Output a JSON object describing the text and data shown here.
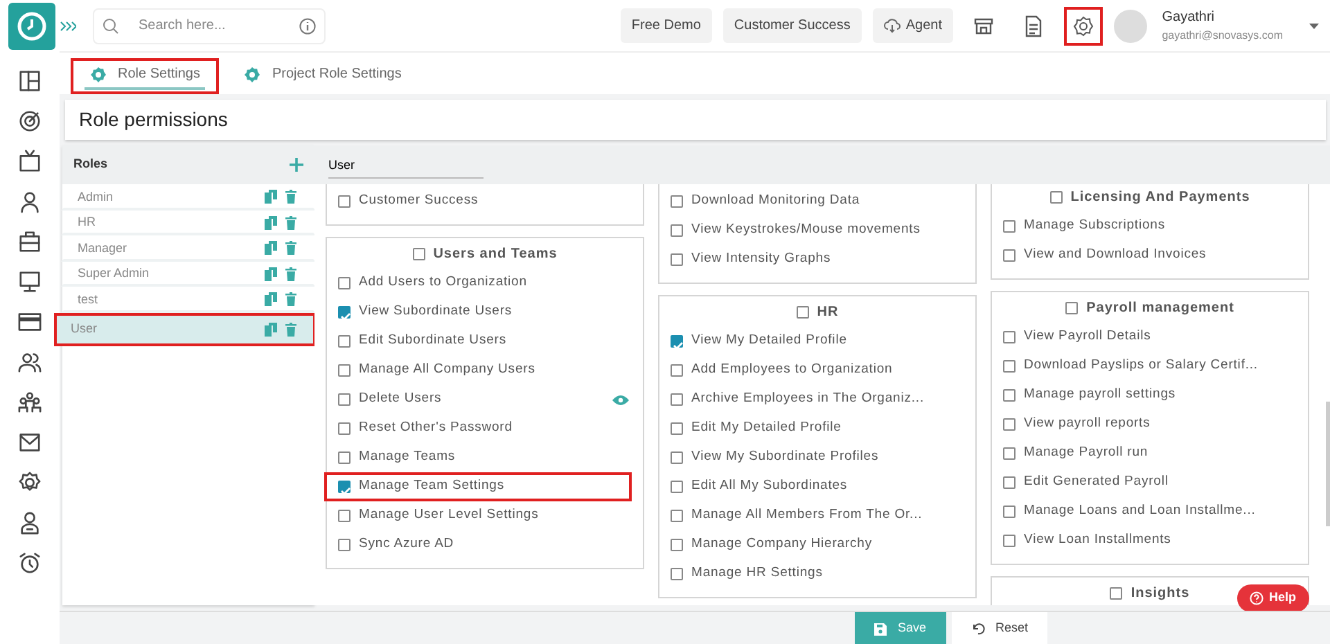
{
  "topbar": {
    "search": {
      "placeholder": "Search here..."
    },
    "buttons": [
      {
        "label": "Free Demo",
        "kind": "text"
      },
      {
        "label": "Customer Success",
        "kind": "text"
      },
      {
        "label": "Agent",
        "kind": "cloud"
      }
    ],
    "icon_buttons": [
      {
        "kind": "store",
        "highlighted": false
      },
      {
        "kind": "document",
        "highlighted": false
      },
      {
        "kind": "settings",
        "highlighted": true
      }
    ],
    "user": {
      "name": "Gayathri",
      "email": "gayathri@snovasys.com"
    }
  },
  "tabs": [
    {
      "label": "Role Settings",
      "selected": true,
      "highlighted": true
    },
    {
      "label": "Project Role Settings",
      "selected": false,
      "highlighted": false
    }
  ],
  "page_title": "Role permissions",
  "roles": {
    "title": "Roles",
    "items": [
      {
        "name": "Admin",
        "selected": false,
        "highlighted": false
      },
      {
        "name": "HR",
        "selected": false,
        "highlighted": false
      },
      {
        "name": "Manager",
        "selected": false,
        "highlighted": false
      },
      {
        "name": "Super Admin",
        "selected": false,
        "highlighted": false
      },
      {
        "name": "test",
        "selected": false,
        "highlighted": false
      },
      {
        "name": "User",
        "selected": true,
        "highlighted": true
      }
    ]
  },
  "role_field": {
    "value": "User"
  },
  "permission_columns": [
    [
      {
        "items": [
          {
            "label": "Customer Success",
            "checked": false,
            "highlighted": false,
            "kind": "plain"
          }
        ]
      },
      {
        "title": "Users and Teams",
        "checked": false,
        "items": [
          {
            "label": "Add Users to Organization",
            "checked": false,
            "highlighted": false,
            "kind": "plain"
          },
          {
            "label": "View Subordinate Users",
            "checked": true,
            "highlighted": false,
            "kind": "plain"
          },
          {
            "label": "Edit Subordinate Users",
            "checked": false,
            "highlighted": false,
            "kind": "plain"
          },
          {
            "label": "Manage All Company Users",
            "checked": false,
            "highlighted": false,
            "kind": "plain"
          },
          {
            "label": "Delete Users",
            "checked": false,
            "highlighted": false,
            "kind": "preview"
          },
          {
            "label": "Reset Other's Password",
            "checked": false,
            "highlighted": false,
            "kind": "plain"
          },
          {
            "label": "Manage Teams",
            "checked": false,
            "highlighted": false,
            "kind": "plain"
          },
          {
            "label": "Manage Team Settings",
            "checked": true,
            "highlighted": true,
            "kind": "plain"
          },
          {
            "label": "Manage User Level Settings",
            "checked": false,
            "highlighted": false,
            "kind": "plain"
          },
          {
            "label": "Sync Azure AD",
            "checked": false,
            "highlighted": false,
            "kind": "plain"
          }
        ]
      }
    ],
    [
      {
        "items": [
          {
            "label": "Download Monitoring Data",
            "checked": false,
            "highlighted": false,
            "kind": "plain"
          },
          {
            "label": "View Keystrokes/Mouse movements",
            "checked": false,
            "highlighted": false,
            "kind": "plain"
          },
          {
            "label": "View Intensity Graphs",
            "checked": false,
            "highlighted": false,
            "kind": "plain"
          }
        ]
      },
      {
        "title": "HR",
        "checked": false,
        "items": [
          {
            "label": "View My Detailed Profile",
            "checked": true,
            "highlighted": false,
            "kind": "plain"
          },
          {
            "label": "Add Employees to Organization",
            "checked": false,
            "highlighted": false,
            "kind": "plain"
          },
          {
            "label": "Archive Employees in The Organiz...",
            "checked": false,
            "highlighted": false,
            "kind": "plain"
          },
          {
            "label": "Edit My Detailed Profile",
            "checked": false,
            "highlighted": false,
            "kind": "plain"
          },
          {
            "label": "View My Subordinate Profiles",
            "checked": false,
            "highlighted": false,
            "kind": "plain"
          },
          {
            "label": "Edit All My Subordinates",
            "checked": false,
            "highlighted": false,
            "kind": "plain"
          },
          {
            "label": "Manage All Members From The Or...",
            "checked": false,
            "highlighted": false,
            "kind": "plain"
          },
          {
            "label": "Manage Company Hierarchy",
            "checked": false,
            "highlighted": false,
            "kind": "plain"
          },
          {
            "label": "Manage HR Settings",
            "checked": false,
            "highlighted": false,
            "kind": "plain"
          }
        ]
      }
    ],
    [
      {
        "title": "Licensing And Payments",
        "checked": false,
        "items": [
          {
            "label": "Manage Subscriptions",
            "checked": false,
            "highlighted": false,
            "kind": "plain"
          },
          {
            "label": "View and Download Invoices",
            "checked": false,
            "highlighted": false,
            "kind": "plain"
          }
        ]
      },
      {
        "title": "Payroll management",
        "checked": false,
        "items": [
          {
            "label": "View Payroll Details",
            "checked": false,
            "highlighted": false,
            "kind": "plain"
          },
          {
            "label": "Download Payslips or Salary Certif...",
            "checked": false,
            "highlighted": false,
            "kind": "plain"
          },
          {
            "label": "Manage payroll settings",
            "checked": false,
            "highlighted": false,
            "kind": "plain"
          },
          {
            "label": "View payroll reports",
            "checked": false,
            "highlighted": false,
            "kind": "plain"
          },
          {
            "label": "Manage Payroll run",
            "checked": false,
            "highlighted": false,
            "kind": "plain"
          },
          {
            "label": "Edit Generated Payroll",
            "checked": false,
            "highlighted": false,
            "kind": "plain"
          },
          {
            "label": "Manage Loans and Loan Installme...",
            "checked": false,
            "highlighted": false,
            "kind": "plain"
          },
          {
            "label": "View Loan Installments",
            "checked": false,
            "highlighted": false,
            "kind": "plain"
          }
        ]
      },
      {
        "title": "Insights",
        "checked": false
      }
    ]
  ],
  "help_button": "Help",
  "footer": {
    "save": "Save",
    "reset": "Reset"
  }
}
